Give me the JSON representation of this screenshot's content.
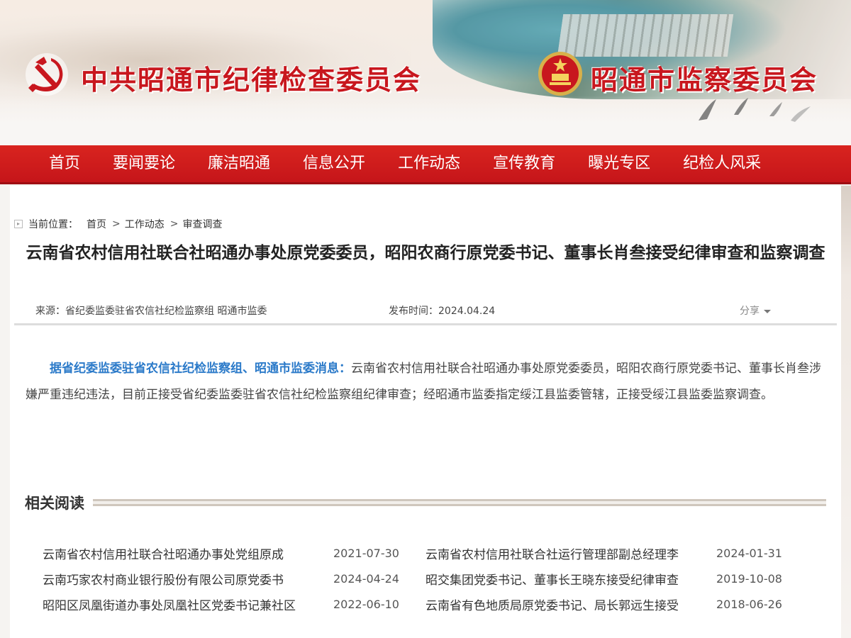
{
  "header": {
    "title_left": "中共昭通市纪律检查委员会",
    "title_right": "昭通市监察委员会",
    "accent_color": "#c8171e"
  },
  "nav": {
    "items": [
      "首页",
      "要闻要论",
      "廉洁昭通",
      "信息公开",
      "工作动态",
      "宣传教育",
      "曝光专区",
      "纪检人风采"
    ]
  },
  "breadcrumb": {
    "label": "当前位置：",
    "items": [
      "首页",
      "工作动态",
      "审查调查"
    ],
    "separator": ">"
  },
  "article": {
    "title": "云南省农村信用社联合社昭通办事处原党委委员，昭阳农商行原党委书记、董事长肖叁接受纪律审查和监察调查",
    "source": "来源：省纪委监委驻省农信社纪检监察组 昭通市监委",
    "publish_date": "发布时间：2024.04.24",
    "share_label": "分享",
    "lead": "据省纪委监委驻省农信社纪检监察组、昭通市监委消息：",
    "body": "云南省农村信用社联合社昭通办事处原党委委员，昭阳农商行原党委书记、董事长肖叁涉嫌严重违纪违法，目前正接受省纪委监委驻省农信社纪检监察组纪律审查；经昭通市监委指定绥江县监委管辖，正接受绥江县监委监察调查。"
  },
  "related": {
    "heading": "相关阅读",
    "rows": [
      [
        {
          "title": "云南省农村信用社联合社昭通办事处党组原成",
          "date": "2021-07-30"
        },
        {
          "title": "云南省农村信用社联合社运行管理部副总经理李",
          "date": "2024-01-31"
        }
      ],
      [
        {
          "title": "云南巧家农村商业银行股份有限公司原党委书",
          "date": "2024-04-24"
        },
        {
          "title": "昭交集团党委书记、董事长王晓东接受纪律审查",
          "date": "2019-10-08"
        }
      ],
      [
        {
          "title": "昭阳区凤凰街道办事处凤凰社区党委书记兼社区",
          "date": "2022-06-10"
        },
        {
          "title": "云南省有色地质局原党委书记、局长郭远生接受",
          "date": "2018-06-26"
        }
      ]
    ]
  }
}
